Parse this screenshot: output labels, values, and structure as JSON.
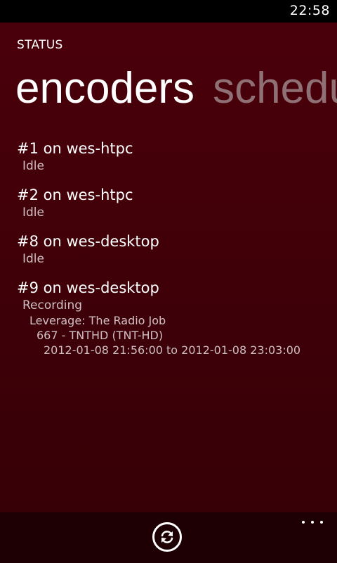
{
  "status_bar": {
    "time": "22:58"
  },
  "app": {
    "title": "STATUS"
  },
  "pivot": {
    "items": [
      {
        "label": "encoders",
        "active": true
      },
      {
        "label": "schedule",
        "active": false
      }
    ]
  },
  "encoders": [
    {
      "name": "#1 on wes-htpc",
      "state": "Idle"
    },
    {
      "name": "#2 on wes-htpc",
      "state": "Idle"
    },
    {
      "name": "#8 on wes-desktop",
      "state": "Idle"
    },
    {
      "name": "#9 on wes-desktop",
      "state": "Recording",
      "program": "Leverage: The Radio Job",
      "channel": "667 - TNTHD (TNT-HD)",
      "time_range": "2012-01-08 21:56:00 to 2012-01-08 23:03:00"
    }
  ],
  "app_bar": {
    "buttons": [
      {
        "icon": "refresh-icon",
        "label": "refresh"
      }
    ],
    "more_icon": "ellipsis-icon"
  },
  "colors": {
    "accent": "#4a000a",
    "app_bar": "#1e0004",
    "inactive_pivot": "#8f7075"
  }
}
